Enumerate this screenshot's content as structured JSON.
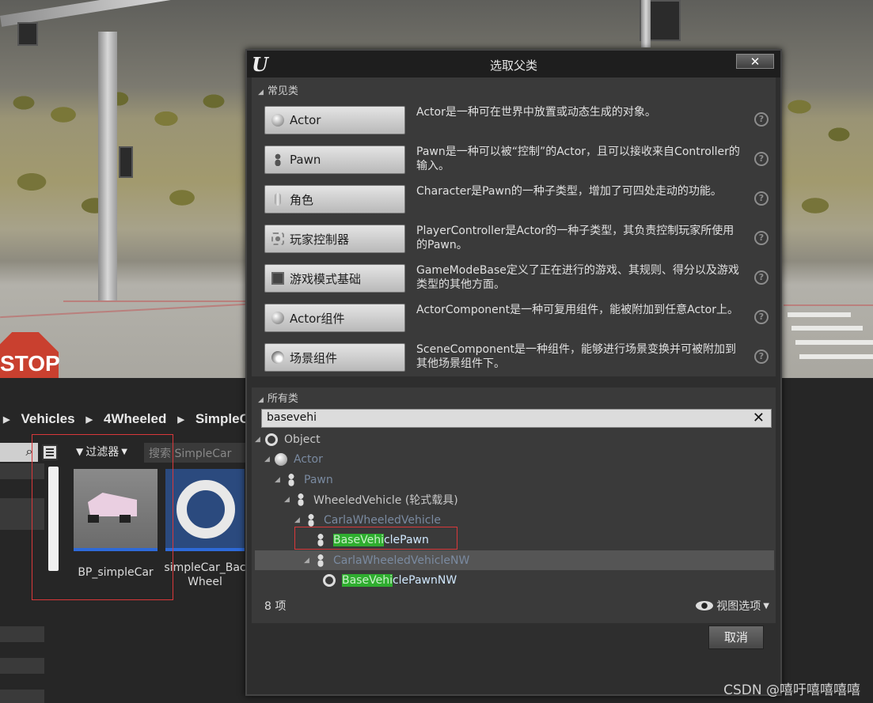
{
  "breadcrumb": [
    "Vehicles",
    "4Wheeled",
    "SimpleC"
  ],
  "content_browser": {
    "filter_label": "过滤器",
    "search_placeholder": "搜索 SimpleCar",
    "assets": [
      {
        "label": "BP_simpleCar"
      },
      {
        "label_line1": "simpleCar_Bac",
        "label_line2": "Wheel"
      }
    ]
  },
  "viewport": {
    "stop_sign_text": "STOP"
  },
  "dialog": {
    "title": "选取父类",
    "close_label": "✕",
    "common_section_label": "常见类",
    "common_classes": [
      {
        "label": "Actor",
        "icon": "actor-ball-icon",
        "desc": "Actor是一种可在世界中放置或动态生成的对象。"
      },
      {
        "label": "Pawn",
        "icon": "pawn-icon",
        "desc": "Pawn是一种可以被“控制”的Actor，且可以接收来自Controller的输入。"
      },
      {
        "label": "角色",
        "icon": "character-capsule-icon",
        "desc": "Character是Pawn的一种子类型，增加了可四处走动的功能。"
      },
      {
        "label": "玩家控制器",
        "icon": "controller-icon",
        "desc": "PlayerController是Actor的一种子类型，其负责控制玩家所使用的Pawn。"
      },
      {
        "label": "游戏模式基础",
        "icon": "game-mode-icon",
        "desc": "GameModeBase定义了正在进行的游戏、其规则、得分以及游戏类型的其他方面。"
      },
      {
        "label": "Actor组件",
        "icon": "actor-component-icon",
        "desc": "ActorComponent是一种可复用组件，能被附加到任意Actor上。"
      },
      {
        "label": "场景组件",
        "icon": "scene-component-icon",
        "desc": "SceneComponent是一种组件，能够进行场景变换并可被附加到其他场景组件下。"
      }
    ],
    "all_section_label": "所有类",
    "search_value": "basevehi",
    "tree": [
      {
        "text": "Object"
      },
      {
        "text": "Actor"
      },
      {
        "text": "Pawn"
      },
      {
        "text": "WheeledVehicle (轮式载具)"
      },
      {
        "text": "CarlaWheeledVehicle"
      },
      {
        "pre": "",
        "match": "BaseVehi",
        "post": "clePawn"
      },
      {
        "text": "CarlaWheeledVehicleNW"
      },
      {
        "pre": "",
        "match": "BaseVehi",
        "post": "clePawnNW"
      }
    ],
    "item_count": "8 项",
    "view_options_label": "视图选项",
    "cancel_label": "取消"
  },
  "watermark": "CSDN @嘻吁嘻嘻嘻嘻"
}
